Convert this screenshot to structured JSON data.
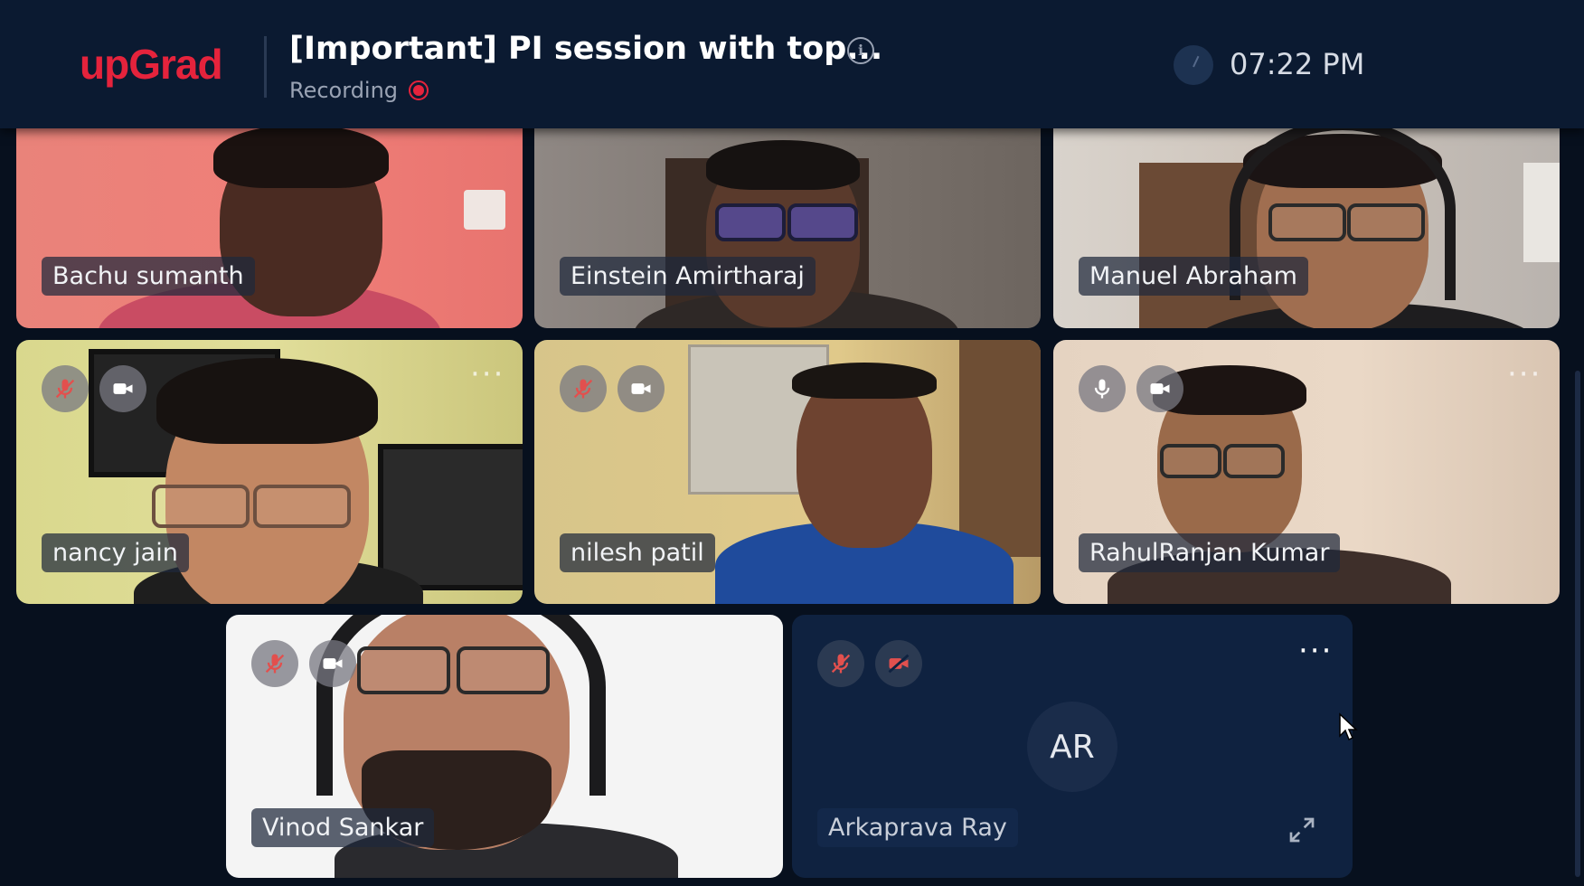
{
  "header": {
    "logo_text": "upGrad",
    "title": "[Important] PI session with top...",
    "recording_label": "Recording",
    "time": "07:22 PM",
    "icons": [
      "info-icon",
      "recording-dot-icon",
      "clock-icon"
    ]
  },
  "participants": [
    {
      "name": "Bachu sumanth"
    },
    {
      "name": "Einstein Amirtharaj"
    },
    {
      "name": "Manuel Abraham"
    },
    {
      "name": "nancy jain",
      "mic": "muted",
      "camera": "on"
    },
    {
      "name": "nilesh patil",
      "mic": "muted",
      "camera": "on"
    },
    {
      "name": "RahulRanjan Kumar",
      "mic": "on",
      "camera": "on"
    },
    {
      "name": "Vinod Sankar",
      "mic": "muted",
      "camera": "on"
    },
    {
      "name": "Arkaprava Ray",
      "initials": "AR",
      "mic": "muted",
      "camera": "off"
    }
  ],
  "icons": {
    "more": "more-options-icon",
    "expand": "expand-icon",
    "cursor": "mouse-cursor-icon"
  },
  "colors": {
    "brand_red": "#e5233c",
    "header_bg": "#0b1a31",
    "page_bg": "#07101e",
    "tile_dark": "#0f2240",
    "muted_red": "#e2504e"
  }
}
